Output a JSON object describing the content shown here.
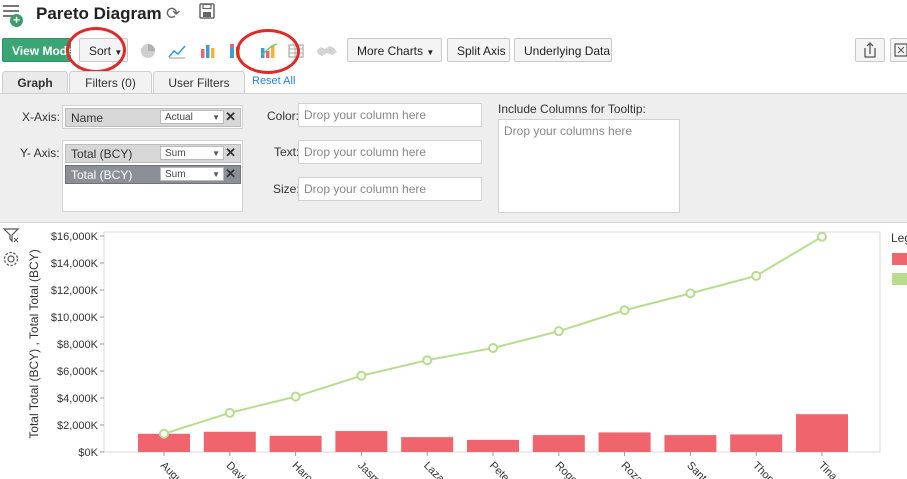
{
  "header": {
    "title": "Pareto Diagram"
  },
  "toolbar": {
    "view_mode": "View Mode",
    "sort": "Sort",
    "more_charts": "More Charts",
    "split_axis": "Split Axis",
    "underlying_data": "Underlying Data"
  },
  "tabs": [
    {
      "label": "Graph"
    },
    {
      "label": "Filters (0)"
    },
    {
      "label": "User Filters"
    }
  ],
  "reset_all": "Reset All",
  "design": {
    "x_axis_label": "X-Axis:",
    "y_axis_label": "Y- Axis:",
    "x_field": {
      "name": "Name",
      "agg": "Actual"
    },
    "y_fields": [
      {
        "name": "Total (BCY)",
        "agg": "Sum"
      },
      {
        "name": "Total (BCY)",
        "agg": "Sum"
      }
    ],
    "color_label": "Color:",
    "text_label": "Text:",
    "size_label": "Size:",
    "drop_placeholder": "Drop your column here",
    "tooltip_label": "Include Columns for Tooltip:",
    "tooltip_placeholder": "Drop your columns here"
  },
  "legend": {
    "title": "Leg"
  },
  "chart_data": {
    "type": "bar",
    "categories": [
      "Augu",
      "Davi",
      "Haro",
      "Jasm",
      "Laza",
      "Pete",
      "Roge",
      "Roza",
      "Sant",
      "Thon",
      "Tina"
    ],
    "series": [
      {
        "type": "bar",
        "values": [
          1350,
          1500,
          1200,
          1550,
          1100,
          900,
          1250,
          1450,
          1250,
          1300,
          2800
        ],
        "color": "#f0646e"
      },
      {
        "type": "line",
        "values": [
          1350,
          2900,
          4100,
          5650,
          6800,
          7700,
          8950,
          10500,
          11750,
          13050,
          15950
        ],
        "color": "#b7dc8d"
      }
    ],
    "y_label": "Total Total (BCY) , Total Total (BCY)",
    "y_ticks": [
      "$0K",
      "$2,000K",
      "$4,000K",
      "$6,000K",
      "$8,000K",
      "$10,000K",
      "$12,000K",
      "$14,000K",
      "$16,000K"
    ],
    "y_range": [
      0,
      16000
    ],
    "grid": false,
    "legend_placement": "right"
  }
}
